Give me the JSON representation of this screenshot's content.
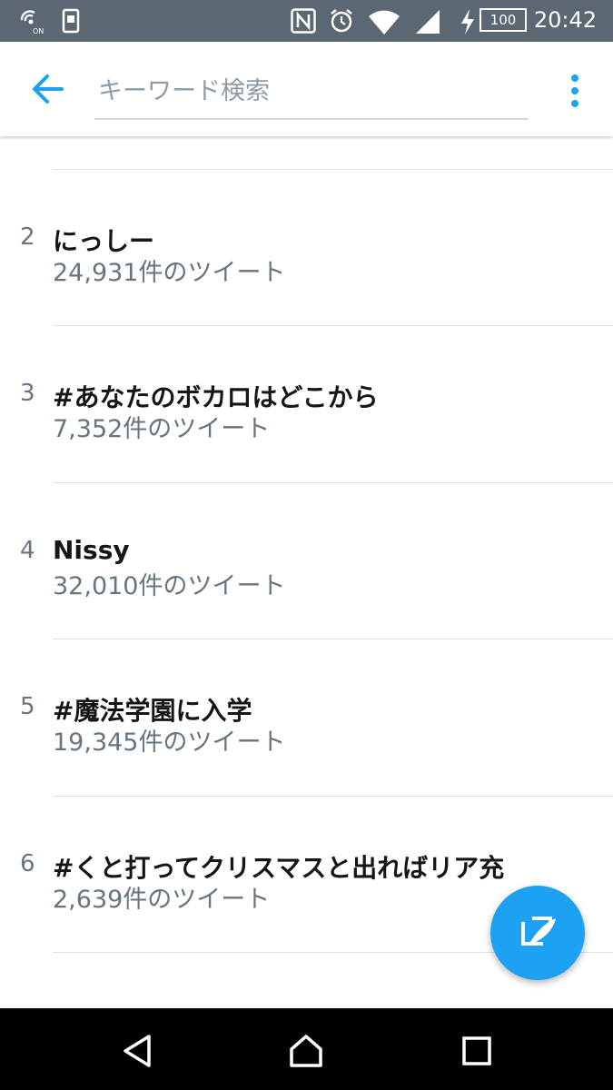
{
  "status_bar": {
    "battery": "100",
    "time": "20:42",
    "icons": [
      "wireless-charging-on-icon",
      "phone-icon",
      "nfc-icon",
      "alarm-icon",
      "wifi-icon",
      "signal-icon",
      "charging-icon",
      "battery-icon"
    ],
    "background_color": "#5b6873"
  },
  "app_bar": {
    "search_placeholder": "キーワード検索",
    "search_value": "",
    "accent_color": "#1da1f2"
  },
  "trends": [
    {
      "rank": "2",
      "term": "にっしー",
      "count": "24,931件のツイート"
    },
    {
      "rank": "3",
      "term": "#あなたのボカロはどこから",
      "count": "7,352件のツイート"
    },
    {
      "rank": "4",
      "term": "Nissy",
      "count": "32,010件のツイート"
    },
    {
      "rank": "5",
      "term": "#魔法学園に入学",
      "count": "19,345件のツイート"
    },
    {
      "rank": "6",
      "term": "#くと打ってクリスマスと出ればリア充",
      "count": "2,639件のツイート"
    }
  ],
  "fab": {
    "icon": "compose-tweet-icon"
  },
  "nav_bar": {
    "buttons": [
      "back-triangle-icon",
      "home-icon",
      "recents-icon"
    ]
  }
}
